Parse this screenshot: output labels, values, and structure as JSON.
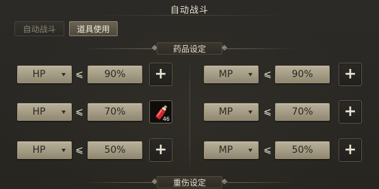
{
  "window": {
    "title": "自动战斗"
  },
  "tabs": [
    {
      "label": "自动战斗",
      "active": false
    },
    {
      "label": "道具使用",
      "active": true
    }
  ],
  "sections": [
    {
      "label": "药品设定"
    },
    {
      "label": "重伤设定"
    }
  ],
  "symbols": {
    "lte": "⩽",
    "plus": "+"
  },
  "left_rows": [
    {
      "stat": "HP",
      "threshold": "90%",
      "slot": "empty"
    },
    {
      "stat": "HP",
      "threshold": "70%",
      "slot": "item",
      "item_icon": "red-potion-icon",
      "item_count": "46"
    },
    {
      "stat": "HP",
      "threshold": "50%",
      "slot": "empty"
    }
  ],
  "right_rows": [
    {
      "stat": "MP",
      "threshold": "90%",
      "slot": "empty"
    },
    {
      "stat": "MP",
      "threshold": "70%",
      "slot": "empty"
    },
    {
      "stat": "MP",
      "threshold": "50%",
      "slot": "empty"
    }
  ],
  "colors": {
    "background": "#2a2823",
    "field": "#a39b84",
    "active_tab": "#5c5647",
    "text": "#e9e3d2"
  }
}
